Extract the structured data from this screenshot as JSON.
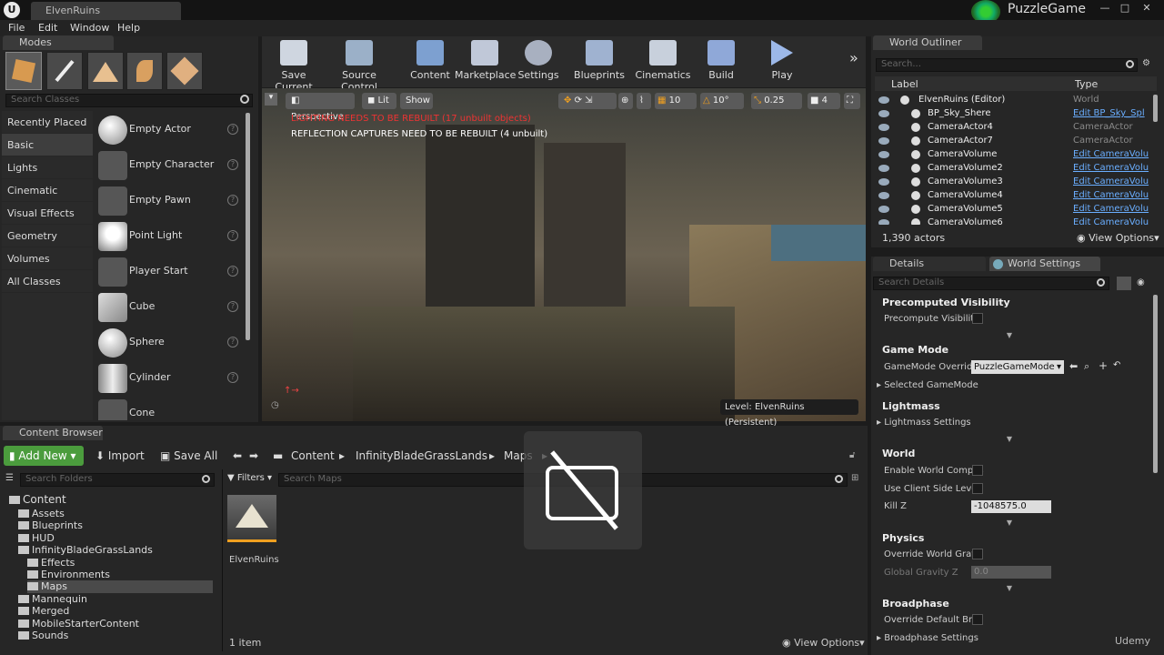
{
  "titlebar": {
    "tab": "ElvenRuins",
    "project": "PuzzleGame",
    "logo": "U"
  },
  "menu": [
    "File",
    "Edit",
    "Window",
    "Help"
  ],
  "modes": {
    "tab": "Modes",
    "search_placeholder": "Search Classes",
    "categories": [
      "Recently Placed",
      "Basic",
      "Lights",
      "Cinematic",
      "Visual Effects",
      "Geometry",
      "Volumes",
      "All Classes"
    ],
    "items": [
      "Empty Actor",
      "Empty Character",
      "Empty Pawn",
      "Point Light",
      "Player Start",
      "Cube",
      "Sphere",
      "Cylinder",
      "Cone"
    ],
    "help": "?"
  },
  "toolbar": [
    "Save Current",
    "Source Control",
    "Content",
    "Marketplace",
    "Settings",
    "Blueprints",
    "Cinematics",
    "Build",
    "Play"
  ],
  "viewport": {
    "perspective": "Perspective",
    "lit": "Lit",
    "show": "Show",
    "warn1": "LIGHTING NEEDS TO BE REBUILT (17 unbuilt objects)",
    "warn2": "REFLECTION CAPTURES NEED TO BE REBUILT (4 unbuilt)",
    "grid": "10",
    "angle": "10°",
    "scale": "0.25",
    "cam_speed": "4",
    "level": "Level:  ElvenRuins (Persistent)"
  },
  "outliner": {
    "tab": "World Outliner",
    "search_placeholder": "Search...",
    "col_label": "Label",
    "col_type": "Type",
    "rows": [
      {
        "label": "ElvenRuins (Editor)",
        "type": "World",
        "link": false
      },
      {
        "label": "BP_Sky_Shere",
        "type": "Edit BP_Sky_Spl",
        "link": true
      },
      {
        "label": "CameraActor4",
        "type": "CameraActor",
        "link": false
      },
      {
        "label": "CameraActor7",
        "type": "CameraActor",
        "link": false
      },
      {
        "label": "CameraVolume",
        "type": "Edit CameraVolu",
        "link": true
      },
      {
        "label": "CameraVolume2",
        "type": "Edit CameraVolu",
        "link": true
      },
      {
        "label": "CameraVolume3",
        "type": "Edit CameraVolu",
        "link": true
      },
      {
        "label": "CameraVolume4",
        "type": "Edit CameraVolu",
        "link": true
      },
      {
        "label": "CameraVolume5",
        "type": "Edit CameraVolu",
        "link": true
      },
      {
        "label": "CameraVolume6",
        "type": "Edit CameraVolu",
        "link": true
      }
    ],
    "count": "1,390 actors",
    "view_options": "View Options"
  },
  "details": {
    "tab_details": "Details",
    "tab_world": "World Settings",
    "search_placeholder": "Search Details",
    "sections": {
      "precomputed": "Precomputed Visibility",
      "gamemode": "Game Mode",
      "lightmass": "Lightmass",
      "world": "World",
      "physics": "Physics",
      "broadphase": "Broadphase"
    },
    "props": {
      "precompute": "Precompute Visibility",
      "gm_override": "GameMode Override",
      "gm_value": "PuzzleGameMode",
      "selected_gm": "Selected GameMode",
      "lm_settings": "Lightmass Settings",
      "enable_comp": "Enable World Compos",
      "client_side": "Use Client Side Level",
      "kill_z": "Kill Z",
      "kill_z_val": "-1048575.0",
      "override_grav": "Override World Gravit",
      "global_grav": "Global Gravity Z",
      "global_grav_val": "0.0",
      "override_broad": "Override Default Broa",
      "broad_settings": "Broadphase Settings"
    }
  },
  "content_browser": {
    "tab": "Content Browser",
    "add_new": "Add New",
    "import": "Import",
    "save_all": "Save All",
    "path": [
      "Content",
      "InfinityBladeGrassLands",
      "Maps"
    ],
    "search_folders": "Search Folders",
    "filters": "Filters",
    "search_maps": "Search Maps",
    "folders": [
      {
        "name": "Content",
        "depth": 0
      },
      {
        "name": "Assets",
        "depth": 1
      },
      {
        "name": "Blueprints",
        "depth": 1
      },
      {
        "name": "HUD",
        "depth": 1
      },
      {
        "name": "InfinityBladeGrassLands",
        "depth": 1
      },
      {
        "name": "Effects",
        "depth": 2
      },
      {
        "name": "Environments",
        "depth": 2
      },
      {
        "name": "Maps",
        "depth": 2
      },
      {
        "name": "Mannequin",
        "depth": 1
      },
      {
        "name": "Merged",
        "depth": 1
      },
      {
        "name": "MobileStarterContent",
        "depth": 1
      },
      {
        "name": "Sounds",
        "depth": 1
      }
    ],
    "asset": "ElvenRuins",
    "item_count": "1 item",
    "view_options": "View Options"
  },
  "watermark": "Udemy",
  "colors": {
    "accent_green": "#4caf50",
    "link_blue": "#6aaeff",
    "selection_orange": "#f0a020"
  }
}
